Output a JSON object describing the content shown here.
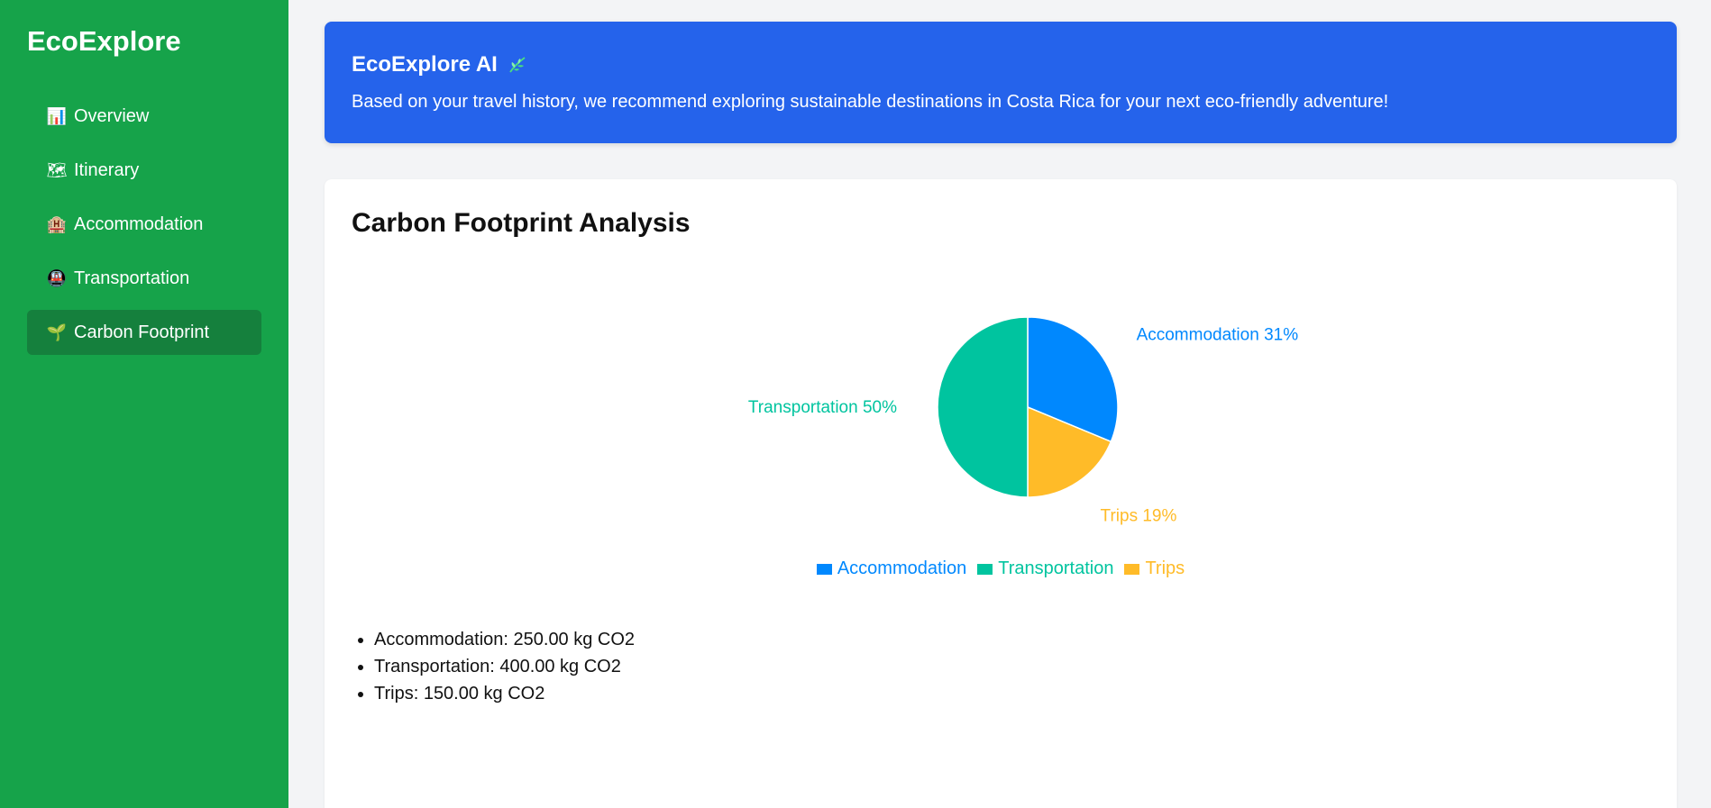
{
  "sidebar": {
    "brand": "EcoExplore",
    "items": [
      {
        "label": "Overview",
        "icon": "bar-chart-icon",
        "glyph": "📊"
      },
      {
        "label": "Itinerary",
        "icon": "map-icon",
        "glyph": "🗺"
      },
      {
        "label": "Accommodation",
        "icon": "hotel-icon",
        "glyph": "🏨"
      },
      {
        "label": "Transportation",
        "icon": "train-icon",
        "glyph": "🚇"
      },
      {
        "label": "Carbon Footprint",
        "icon": "seedling-icon",
        "glyph": "🌱",
        "active": true
      }
    ]
  },
  "ai_banner": {
    "title": "EcoExplore AI",
    "icon": "leaf-icon",
    "message": "Based on your travel history, we recommend exploring sustainable destinations in Costa Rica for your next eco-friendly adventure!"
  },
  "carbon": {
    "title": "Carbon Footprint Analysis",
    "breakdown": [
      "Accommodation: 250.00 kg CO2",
      "Transportation: 400.00 kg CO2",
      "Trips: 150.00 kg CO2"
    ]
  },
  "colors": {
    "sidebar": "#16a34a",
    "sidebar_active": "#15803d",
    "banner": "#2563eb",
    "accommodation": "#0088fe",
    "transportation": "#00c49f",
    "trips": "#ffbb28"
  },
  "chart_data": {
    "type": "pie",
    "categories": [
      "Accommodation",
      "Transportation",
      "Trips"
    ],
    "values": [
      250,
      400,
      150
    ],
    "slice_labels": [
      "Accommodation 31%",
      "Transportation 50%",
      "Trips 19%"
    ],
    "colors": [
      "#0088fe",
      "#00c49f",
      "#ffbb28"
    ],
    "legend": [
      "Accommodation",
      "Transportation",
      "Trips"
    ],
    "legend_position": "bottom"
  }
}
